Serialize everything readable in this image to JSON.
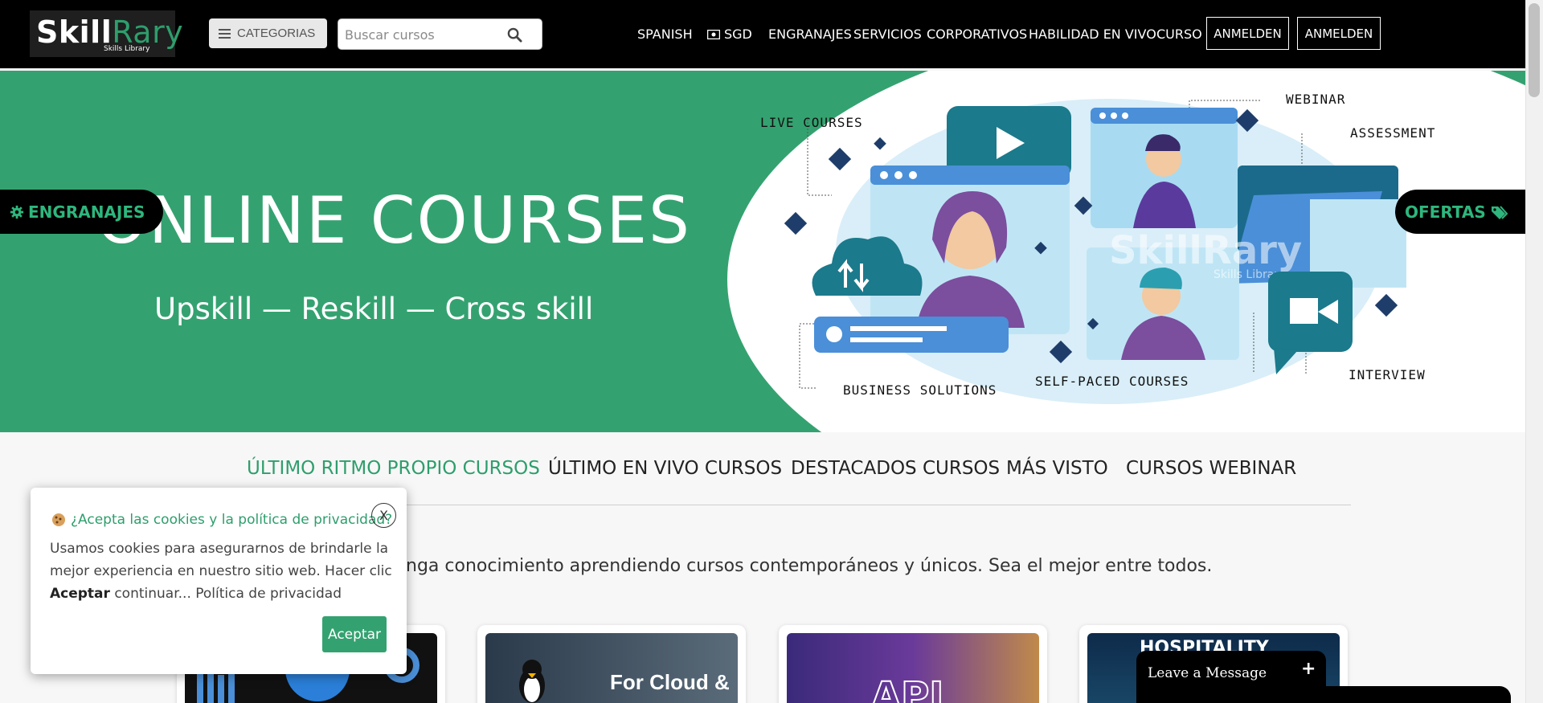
{
  "header": {
    "logo": {
      "part1": "Skill",
      "part2": "Rary",
      "subtitle": "Skills Library"
    },
    "categories_label": "CATEGORIAS",
    "search": {
      "placeholder": "Buscar cursos",
      "value": ""
    },
    "nav": {
      "language": "SPANISH",
      "currency": "SGD",
      "items": [
        "ENGRANAJES",
        "SERVICIOS",
        "CORPORATIVOS",
        "HABILIDAD EN VIVO",
        "CURSO"
      ],
      "buttons": [
        "ANMELDEN",
        "ANMELDEN"
      ]
    }
  },
  "banner": {
    "title": "ONLINE COURSES",
    "subtitle": "Upskill  —  Reskill  —  Cross skill",
    "labels": {
      "live_courses": "LIVE COURSES",
      "webinar": "WEBINAR",
      "assessment": "ASSESSMENT",
      "business_solutions": "BUSINESS SOLUTIONS",
      "self_paced": "SELF-PACED COURSES",
      "interview": "INTERVIEW"
    },
    "watermark": "SkillRary",
    "watermark_sub": "Skills Library",
    "side_left": "ENGRANAJES",
    "side_right": "OFERTAS"
  },
  "tabs": {
    "active": {
      "highlight": "ÚLTIMO",
      "rest": " RITMO PROPIO CURSOS"
    },
    "others": [
      "ÚLTIMO EN VIVO CURSOS",
      "DESTACADOS CURSOS",
      "MÁS VISTO",
      "CURSOS WEBINAR"
    ]
  },
  "tagline": "nga conocimiento aprendiendo cursos contemporáneos y únicos. Sea el mejor entre todos.",
  "cards": [
    {
      "image_text": ""
    },
    {
      "image_text": "For Cloud &"
    },
    {
      "image_text": "API"
    },
    {
      "image_text": "HOSPITALITY"
    }
  ],
  "cookie": {
    "title": "¿Acepta las cookies y la política de privacidad?",
    "close": "X",
    "body_pre": "Usamos cookies para asegurarnos de brindarle la mejor experiencia en nuestro sitio web. Hacer clic ",
    "body_bold": "Aceptar",
    "body_post": " continuar... ",
    "policy_link": "Política de privacidad",
    "accept": "Aceptar"
  },
  "chat": {
    "label": "Leave a Message",
    "toggle": "+"
  },
  "colors": {
    "brand_green": "#34a270",
    "header_bg": "#000000"
  }
}
